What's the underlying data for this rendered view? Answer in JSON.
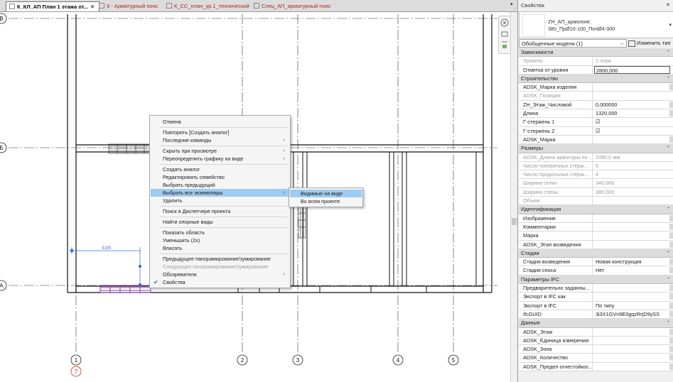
{
  "tabs": [
    {
      "label": "К_КЛ_АП План 1 этажа от...",
      "active": true
    },
    {
      "label": "9 - Арматурный пояс",
      "active": false
    },
    {
      "label": "К_СС_план_ур.1_технический",
      "active": false
    },
    {
      "label": "Спец_АП_арматурный пояс",
      "active": false
    }
  ],
  "tab_close": "✕",
  "tab_overflow": "▾",
  "grid_bubbles": {
    "horizontal": [
      "В",
      "Б",
      "А"
    ],
    "vertical": [
      "1",
      "2",
      "3",
      "4",
      "5"
    ],
    "extra": "7"
  },
  "dimension_text": "3100",
  "context_menu": {
    "items": [
      {
        "label": "Отмена"
      },
      {
        "label": "Повторить [Создать аналог]"
      },
      {
        "label": "Последние команды",
        "arrow": true
      },
      {
        "label": "Скрыть при просмотре",
        "arrow": true
      },
      {
        "label": "Переопределить графику на виде",
        "arrow": true
      },
      {
        "label": "Создать аналог"
      },
      {
        "label": "Редактировать семейство"
      },
      {
        "label": "Выбрать предыдущий"
      },
      {
        "label": "Выбрать все экземпляры",
        "arrow": true,
        "highlighted": true
      },
      {
        "label": "Удалить"
      },
      {
        "label": "Поиск в Диспетчере проекта"
      },
      {
        "label": "Найти опорные виды"
      },
      {
        "label": "Показать область"
      },
      {
        "label": "Уменьшить (2x)"
      },
      {
        "label": "Вписать"
      },
      {
        "label": "Предыдущее панорамирование/зумирование"
      },
      {
        "label": "Следующее панорамирование/зумирование",
        "disabled": true
      },
      {
        "label": "Обозреватели",
        "arrow": true
      },
      {
        "label": "Свойства",
        "checked": true
      }
    ],
    "submenu": [
      {
        "label": "Видимые на виде",
        "highlighted": true
      },
      {
        "label": "Во всем проекте"
      }
    ]
  },
  "properties": {
    "title": "Свойства",
    "close": "✕",
    "type_name_line1": "ZH_АП_армопояс",
    "type_name_line2": "380_ПрØ10-100_ПопØ4-300",
    "filter": "Обобщенные модели (1)",
    "edit_type": "Изменить тип",
    "groups": [
      {
        "title": "Зависимости",
        "rows": [
          {
            "key": "Уровень",
            "value": "1 этаж",
            "disabled": true
          },
          {
            "key": "Отметка от уровня",
            "value": "2800,000",
            "editing": true
          }
        ]
      },
      {
        "title": "Строительство",
        "rows": [
          {
            "key": "ADSK_Марка изделия",
            "value": ""
          },
          {
            "key": "ADSK_Позиция",
            "value": "",
            "disabled": true
          },
          {
            "key": "ZH_Этаж_Числовой",
            "value": "0,000000"
          },
          {
            "key": "Длина",
            "value": "1320,000"
          },
          {
            "key": "Г-стержень 1",
            "value": "☑",
            "checkbox": true
          },
          {
            "key": "Г-стержень 2",
            "value": "☑",
            "checkbox": true
          },
          {
            "key": "ADSK_Марка",
            "value": ""
          }
        ]
      },
      {
        "title": "Размеры",
        "rows": [
          {
            "key": "ADSK_Длина арматуры по ...",
            "value": "2080,0 мм",
            "disabled": true
          },
          {
            "key": "Число поперечных стерж...",
            "value": "5",
            "disabled": true
          },
          {
            "key": "Число продольных стерж...",
            "value": "4",
            "disabled": true
          },
          {
            "key": "Ширина сетки",
            "value": "340,000",
            "disabled": true
          },
          {
            "key": "Ширина стены",
            "value": "380,000",
            "disabled": true
          },
          {
            "key": "Объем",
            "value": "",
            "disabled": true
          }
        ]
      },
      {
        "title": "Идентификация",
        "rows": [
          {
            "key": "Изображение",
            "value": ""
          },
          {
            "key": "Комментарии",
            "value": ""
          },
          {
            "key": "Марка",
            "value": ""
          },
          {
            "key": "ADSK_Этап возведения",
            "value": ""
          }
        ]
      },
      {
        "title": "Стадии",
        "rows": [
          {
            "key": "Стадия возведения",
            "value": "Новая конструкция"
          },
          {
            "key": "Стадия сноса",
            "value": "Нет"
          }
        ]
      },
      {
        "title": "Параметры IFC",
        "rows": [
          {
            "key": "Предварительно заданны...",
            "value": ""
          },
          {
            "key": "Экспорт в IFC как",
            "value": ""
          },
          {
            "key": "Экспорт в IFC",
            "value": "По типу"
          },
          {
            "key": "IfcGUID",
            "value": "3i3X1GVn9E0gqzRrjD9ySS"
          }
        ]
      },
      {
        "title": "Данные",
        "rows": [
          {
            "key": "ADSK_Этаж",
            "value": ""
          },
          {
            "key": "ADSK_Единица измерения",
            "value": ""
          },
          {
            "key": "ADSK_Зона",
            "value": ""
          },
          {
            "key": "ADSK_Количество",
            "value": ""
          },
          {
            "key": "ADSK_Предел огнестойкос...",
            "value": ""
          }
        ]
      }
    ]
  },
  "colors": {
    "highlight": "#9ecbf0",
    "selected_element": "#8b3fa8",
    "grid_bubble_red": "#d62828"
  }
}
